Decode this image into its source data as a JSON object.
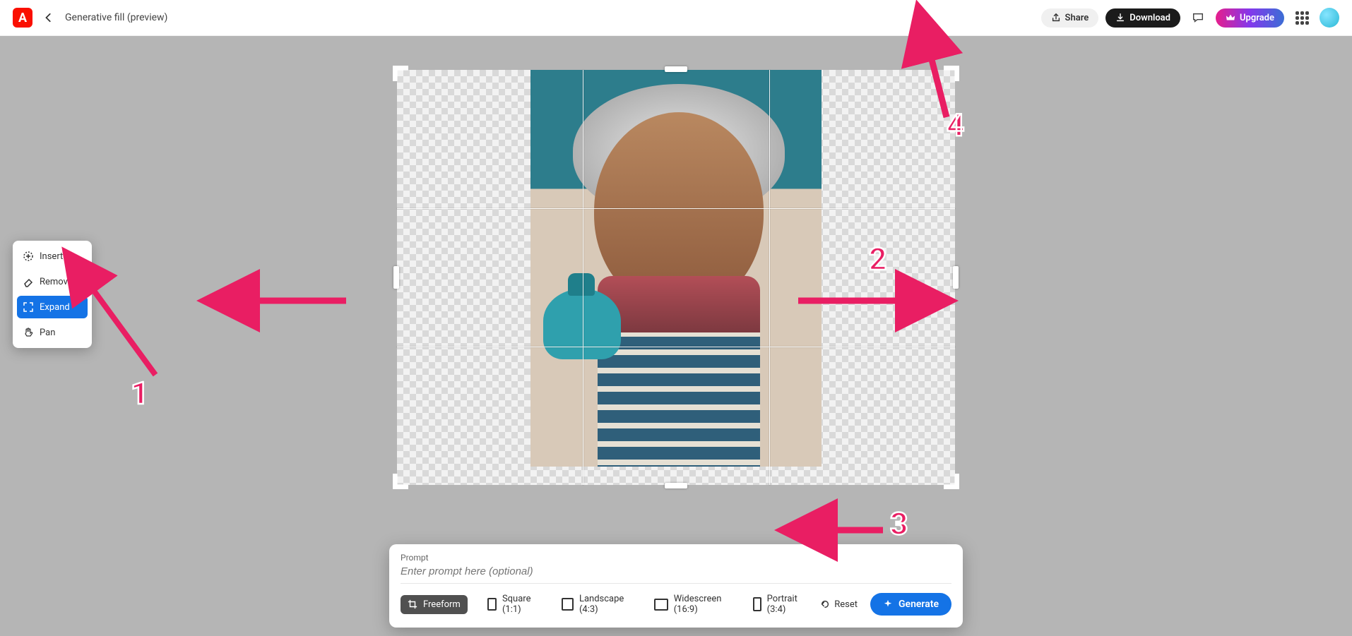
{
  "header": {
    "logo_letter": "A",
    "page_title": "Generative fill (preview)",
    "share_label": "Share",
    "download_label": "Download",
    "upgrade_label": "Upgrade"
  },
  "tools": {
    "insert": "Insert",
    "remove": "Remove",
    "expand": "Expand",
    "pan": "Pan"
  },
  "prompt": {
    "label": "Prompt",
    "placeholder": "Enter prompt here (optional)"
  },
  "options": {
    "freeform": "Freeform",
    "square": "Square (1:1)",
    "landscape": "Landscape (4:3)",
    "widescreen": "Widescreen (16:9)",
    "portrait": "Portrait (3:4)",
    "reset": "Reset",
    "generate": "Generate"
  },
  "annotations": {
    "n1": "1",
    "n2": "2",
    "n3": "3",
    "n4": "4"
  }
}
